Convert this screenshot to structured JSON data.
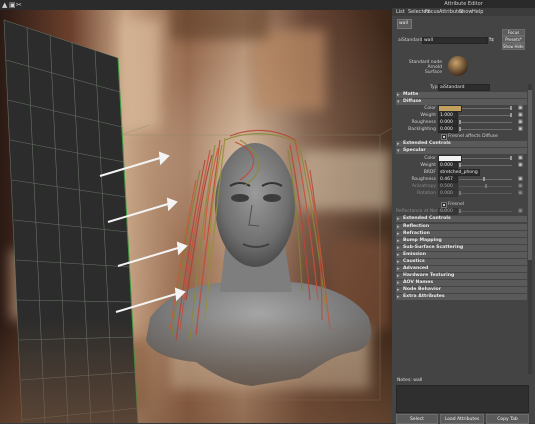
{
  "viewport": {
    "toolbar_glyphs": [
      "▲",
      "▣",
      "✂"
    ]
  },
  "attribute_editor": {
    "title": "Attribute Editor",
    "menu": [
      "List",
      "Selected",
      "Focus",
      "Attributes",
      "Show",
      "Help"
    ],
    "tab": "wall",
    "node_type_label": "aiStandard:",
    "node_name": "wall",
    "focus_button": "Focus",
    "presets_button": "Presets*",
    "show_button": "Show",
    "hide_button": "Hide",
    "swatch_caption": "Standard node\nArnold\nSurface",
    "type_label": "Type",
    "type_value": "aiStandard",
    "sections": {
      "matte": "Matte",
      "diffuse": "Diffuse",
      "extended1": "Extended Controls",
      "specular": "Specular",
      "extended2": "Extended Controls",
      "reflection": "Reflection",
      "refraction": "Refraction",
      "bump": "Bump Mapping",
      "sss": "Sub-Surface Scattering",
      "emission": "Emission",
      "caustics": "Caustics",
      "advanced": "Advanced",
      "hardware": "Hardware Texturing",
      "aov": "AOV Names",
      "node_behavior": "Node Behavior",
      "extra": "Extra Attributes"
    },
    "diffuse": {
      "color_label": "Color",
      "color_hex": "#c2a160",
      "weight_label": "Weight",
      "weight_value": "1.000",
      "roughness_label": "Roughness",
      "roughness_value": "0.000",
      "backlighting_label": "Backlighting",
      "backlighting_value": "0.000",
      "fresnel_label": "Fresnel affects Diffuse"
    },
    "specular": {
      "color_label": "Color",
      "color_hex": "#f2f2f2",
      "weight_label": "Weight",
      "weight_value": "0.000",
      "brdf_label": "BRDF",
      "brdf_value": "stretched_phong",
      "roughness_label": "Roughness",
      "roughness_value": "0.467",
      "anisotropy_label": "Anisotropy",
      "anisotropy_value": "0.500",
      "rotation_label": "Rotation",
      "rotation_value": "0.000",
      "fresnel_label": "Fresnel",
      "reflectance_label": "Reflectance at Normal",
      "reflectance_value": "0.000"
    },
    "notes_label": "Notes:  wall",
    "bottom_buttons": [
      "Select",
      "Load Attributes",
      "Copy Tab"
    ]
  }
}
